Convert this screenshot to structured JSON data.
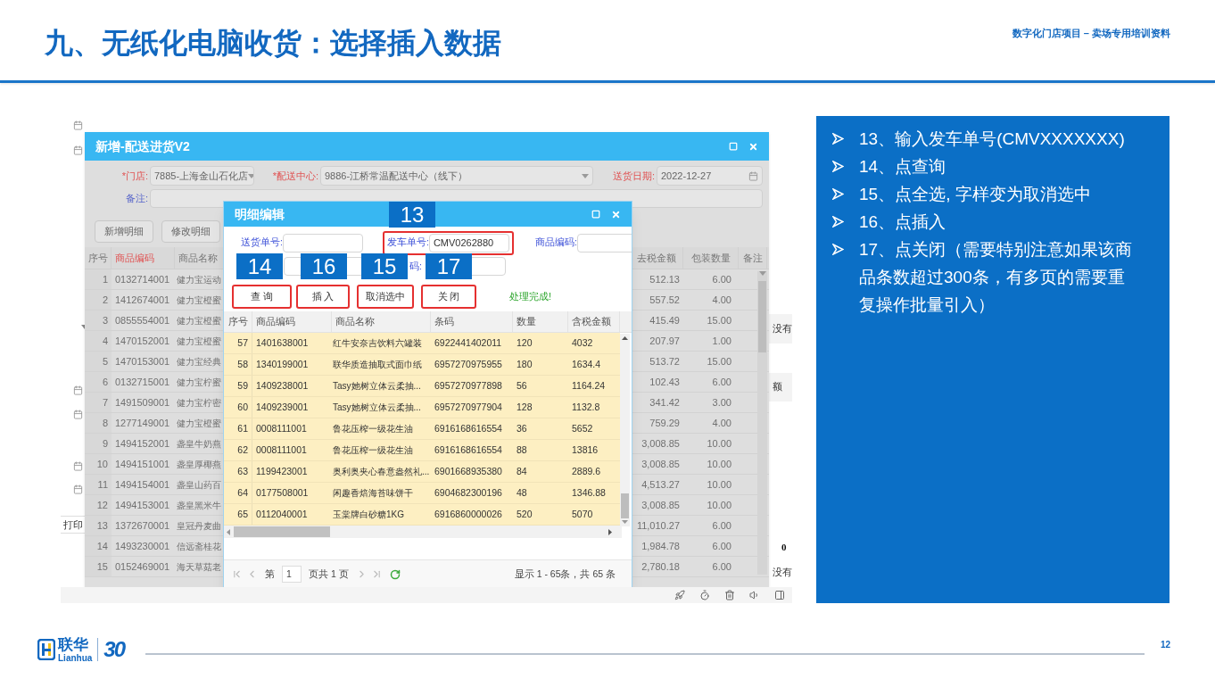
{
  "header": {
    "title": "九、无纸化电脑收货：选择插入数据",
    "subtitle": "数字化门店项目 – 卖场专用培训资料"
  },
  "background_app": {
    "print_button": "打印",
    "right_texts": [
      "没有",
      "额",
      "0",
      "没有"
    ]
  },
  "main_dialog": {
    "title": "新增-配送进货V2",
    "fields": [
      {
        "label": "*门店:",
        "value": "7885-上海金山石化店",
        "kind": "select",
        "highlight": true
      },
      {
        "label": "*配送中心:",
        "value": "9886-江桥常温配送中心（线下）",
        "kind": "select",
        "highlight": true
      },
      {
        "label": "送货日期:",
        "value": "2022-12-27",
        "kind": "date",
        "highlight": true
      }
    ],
    "remark_label": "备注:",
    "buttons": [
      "新增明细",
      "修改明细"
    ],
    "columns": [
      {
        "label": "序号",
        "highlight": false
      },
      {
        "label": "商品编码",
        "highlight": true
      },
      {
        "label": "商品名称",
        "highlight": false
      },
      {
        "label": "去税金额",
        "highlight": false
      },
      {
        "label": "包装数量",
        "highlight": false
      },
      {
        "label": "备注",
        "highlight": false
      }
    ],
    "rows": [
      {
        "no": "1",
        "code": "0132714001",
        "name": "健力宝运动",
        "amount": "512.13",
        "pack": "6.00"
      },
      {
        "no": "2",
        "code": "1412674001",
        "name": "健力宝橙蜜",
        "amount": "557.52",
        "pack": "4.00"
      },
      {
        "no": "3",
        "code": "0855554001",
        "name": "健力宝橙蜜",
        "amount": "415.49",
        "pack": "15.00"
      },
      {
        "no": "4",
        "code": "1470152001",
        "name": "健力宝橙蜜",
        "amount": "207.97",
        "pack": "1.00"
      },
      {
        "no": "5",
        "code": "1470153001",
        "name": "健力宝经典",
        "amount": "513.72",
        "pack": "15.00"
      },
      {
        "no": "6",
        "code": "0132715001",
        "name": "健力宝柠蜜",
        "amount": "102.43",
        "pack": "6.00"
      },
      {
        "no": "7",
        "code": "1491509001",
        "name": "健力宝柠密",
        "amount": "341.42",
        "pack": "3.00"
      },
      {
        "no": "8",
        "code": "1277149001",
        "name": "健力宝橙蜜",
        "amount": "759.29",
        "pack": "4.00"
      },
      {
        "no": "9",
        "code": "1494152001",
        "name": "盏皇牛奶燕",
        "amount": "3,008.85",
        "pack": "10.00"
      },
      {
        "no": "10",
        "code": "1494151001",
        "name": "盏皇厚椰燕",
        "amount": "3,008.85",
        "pack": "10.00"
      },
      {
        "no": "11",
        "code": "1494154001",
        "name": "盏皇山药百",
        "amount": "4,513.27",
        "pack": "10.00"
      },
      {
        "no": "12",
        "code": "1494153001",
        "name": "盏皇黑米牛",
        "amount": "3,008.85",
        "pack": "10.00"
      },
      {
        "no": "13",
        "code": "1372670001",
        "name": "皇冠丹麦曲",
        "amount": "11,010.27",
        "pack": "6.00"
      },
      {
        "no": "14",
        "code": "1493230001",
        "name": "信远斋桂花",
        "amount": "1,984.78",
        "pack": "6.00"
      },
      {
        "no": "15",
        "code": "0152469001",
        "name": "海天草菇老",
        "amount": "2,780.18",
        "pack": "6.00"
      }
    ]
  },
  "detail_dialog": {
    "title": "明细编辑",
    "field_rows": [
      [
        {
          "label": "送货单号:",
          "kind": "input"
        },
        {
          "label": "发车单号:",
          "value": "CMV0262880",
          "kind": "input",
          "step": "13",
          "outlined": true
        },
        {
          "label": "商品编码:",
          "kind": "input"
        }
      ],
      [
        {
          "kind": "input"
        },
        {
          "label": "码:",
          "kind": "input"
        }
      ]
    ],
    "buttons": [
      {
        "label": "查 询",
        "step": "14",
        "outlined": true
      },
      {
        "label": "插 入",
        "step": "16",
        "outlined": true
      },
      {
        "label": "取消选中",
        "step": "15",
        "outlined": true
      },
      {
        "label": "关 闭",
        "step": "17",
        "outlined": true
      }
    ],
    "status": "处理完成!",
    "columns": [
      "序号",
      "商品编码",
      "商品名称",
      "条码",
      "数量",
      "含税金额"
    ],
    "rows": [
      {
        "no": "57",
        "code": "1401638001",
        "name": "红牛安奈吉饮料六罐装",
        "barcode": "6922441402011",
        "qty": "120",
        "amount": "4032",
        "selected": true
      },
      {
        "no": "58",
        "code": "1340199001",
        "name": "联华质造抽取式面巾纸",
        "barcode": "6957270975955",
        "qty": "180",
        "amount": "1634.4",
        "selected": true
      },
      {
        "no": "59",
        "code": "1409238001",
        "name": "Tasy她树立体云柔抽...",
        "barcode": "6957270977898",
        "qty": "56",
        "amount": "1164.24",
        "selected": true
      },
      {
        "no": "60",
        "code": "1409239001",
        "name": "Tasy她树立体云柔抽...",
        "barcode": "6957270977904",
        "qty": "128",
        "amount": "1132.8",
        "selected": true
      },
      {
        "no": "61",
        "code": "0008111001",
        "name": "鲁花压榨一级花生油",
        "barcode": "6916168616554",
        "qty": "36",
        "amount": "5652",
        "selected": true
      },
      {
        "no": "62",
        "code": "0008111001",
        "name": "鲁花压榨一级花生油",
        "barcode": "6916168616554",
        "qty": "88",
        "amount": "13816",
        "selected": true
      },
      {
        "no": "63",
        "code": "1199423001",
        "name": "奥利奥夹心春意盎然礼...",
        "barcode": "6901668935380",
        "qty": "84",
        "amount": "2889.6",
        "selected": true
      },
      {
        "no": "64",
        "code": "0177508001",
        "name": "闲趣香焙海苔味饼干",
        "barcode": "6904682300196",
        "qty": "48",
        "amount": "1346.88",
        "selected": true
      },
      {
        "no": "65",
        "code": "0112040001",
        "name": "玉棠牌白砂糖1KG",
        "barcode": "6916860000026",
        "qty": "520",
        "amount": "5070",
        "selected": true
      }
    ],
    "pager": {
      "before": "第",
      "page": "1",
      "after": "页共 1 页",
      "summary": "显示 1 - 65条，共 65 条"
    }
  },
  "steps": [
    "13、输入发车单号(CMVXXXXXXX)",
    "14、点查询",
    "15、点全选, 字样变为取消选中",
    "16、点插入",
    "17、点关闭（需要特别注意如果该商品条数超过300条，有多页的需要重复操作批量引入）"
  ],
  "footer": {
    "logo_name": "联华",
    "logo_latin": "Lianhua",
    "mark": "30",
    "page_number": "12"
  }
}
